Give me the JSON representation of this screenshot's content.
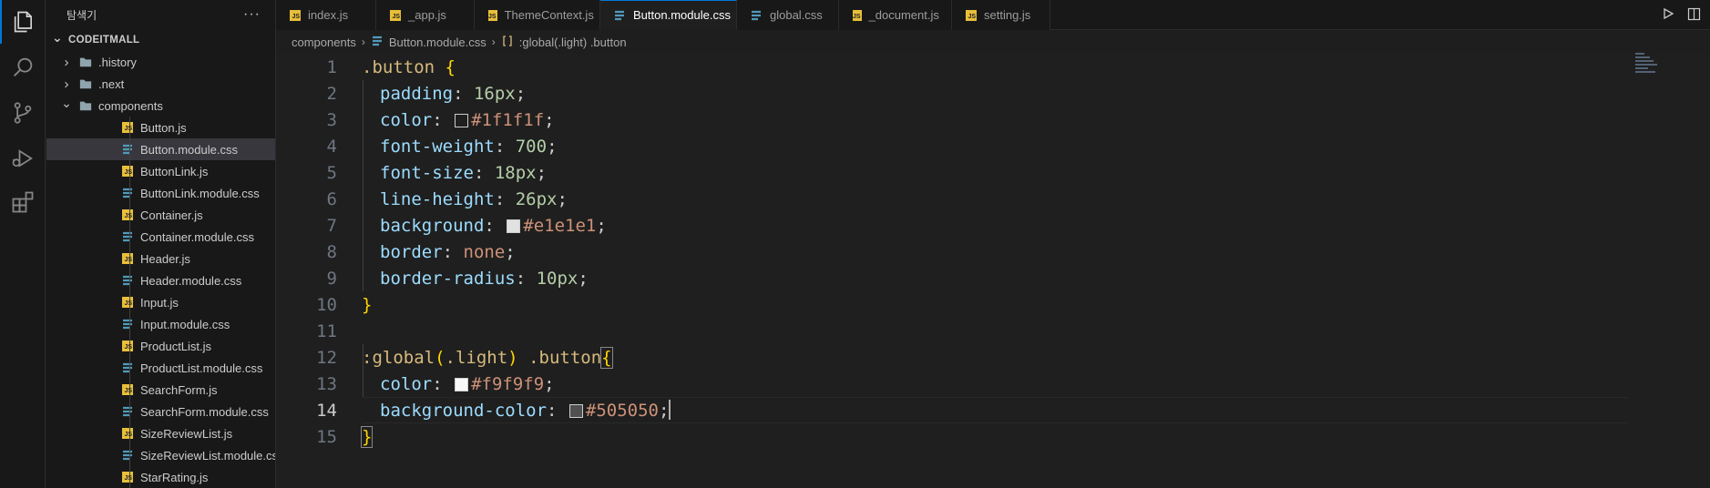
{
  "sidebar": {
    "title": "탐색기",
    "more_label": "···",
    "root": "CODEITMALL",
    "items": [
      {
        "label": ".history",
        "kind": "folder",
        "state": "collapsed"
      },
      {
        "label": ".next",
        "kind": "folder",
        "state": "collapsed"
      },
      {
        "label": "components",
        "kind": "folder",
        "state": "expanded"
      },
      {
        "label": "Button.js",
        "kind": "js"
      },
      {
        "label": "Button.module.css",
        "kind": "css",
        "selected": true
      },
      {
        "label": "ButtonLink.js",
        "kind": "js"
      },
      {
        "label": "ButtonLink.module.css",
        "kind": "css"
      },
      {
        "label": "Container.js",
        "kind": "js"
      },
      {
        "label": "Container.module.css",
        "kind": "css"
      },
      {
        "label": "Header.js",
        "kind": "js"
      },
      {
        "label": "Header.module.css",
        "kind": "css"
      },
      {
        "label": "Input.js",
        "kind": "js"
      },
      {
        "label": "Input.module.css",
        "kind": "css"
      },
      {
        "label": "ProductList.js",
        "kind": "js"
      },
      {
        "label": "ProductList.module.css",
        "kind": "css"
      },
      {
        "label": "SearchForm.js",
        "kind": "js"
      },
      {
        "label": "SearchForm.module.css",
        "kind": "css"
      },
      {
        "label": "SizeReviewList.js",
        "kind": "js"
      },
      {
        "label": "SizeReviewList.module.css",
        "kind": "css"
      },
      {
        "label": "StarRating.js",
        "kind": "js"
      }
    ]
  },
  "tabs": [
    {
      "label": "index.js",
      "kind": "js"
    },
    {
      "label": "_app.js",
      "kind": "js"
    },
    {
      "label": "ThemeContext.js",
      "kind": "js"
    },
    {
      "label": "Button.module.css",
      "kind": "css",
      "active": true,
      "close": "✕"
    },
    {
      "label": "global.css",
      "kind": "css"
    },
    {
      "label": "_document.js",
      "kind": "js"
    },
    {
      "label": "setting.js",
      "kind": "js"
    }
  ],
  "tab_actions": [
    "run-icon",
    "split-editor-icon"
  ],
  "breadcrumb": {
    "folder": "components",
    "file": "Button.module.css",
    "symbol": ":global(.light) .button"
  },
  "icons": {
    "js_badge": "JS",
    "chevron_right": "›",
    "chevron_down": "⌄"
  },
  "editor": {
    "current_line": 14,
    "line_numbers": [
      "1",
      "2",
      "3",
      "4",
      "5",
      "6",
      "7",
      "8",
      "9",
      "10",
      "11",
      "12",
      "13",
      "14",
      "15"
    ],
    "lines": {
      "l1": {
        "selector": ".button",
        "brace": " {"
      },
      "l2": {
        "prop": "padding",
        "colon": ": ",
        "value": "16px",
        "semi": ";"
      },
      "l3": {
        "prop": "color",
        "colon": ": ",
        "value": "#1f1f1f",
        "semi": ";",
        "swatch": "#1f1f1f"
      },
      "l4": {
        "prop": "font-weight",
        "colon": ": ",
        "value": "700",
        "semi": ";"
      },
      "l5": {
        "prop": "font-size",
        "colon": ": ",
        "value": "18px",
        "semi": ";"
      },
      "l6": {
        "prop": "line-height",
        "colon": ": ",
        "value": "26px",
        "semi": ";"
      },
      "l7": {
        "prop": "background",
        "colon": ": ",
        "value": "#e1e1e1",
        "semi": ";",
        "swatch": "#e1e1e1"
      },
      "l8": {
        "prop": "border",
        "colon": ": ",
        "value": "none",
        "semi": ";"
      },
      "l9": {
        "prop": "border-radius",
        "colon": ": ",
        "value": "10px",
        "semi": ";"
      },
      "l10": {
        "brace": "}"
      },
      "l12": {
        "pseudo": ":global",
        "paren_open": "(",
        "inner": ".light",
        "paren_close": ")",
        "selector": " .button",
        "brace": "{"
      },
      "l13": {
        "prop": "color",
        "colon": ": ",
        "value": "#f9f9f9",
        "semi": ";",
        "swatch": "#f9f9f9"
      },
      "l14": {
        "prop": "background-color",
        "colon": ": ",
        "value": "#505050",
        "semi": ";",
        "swatch": "#505050"
      },
      "l15": {
        "brace": "}"
      }
    }
  },
  "colors": {
    "accent": "#0078d4",
    "js_icon": "#e8bf3a",
    "css_icon": "#519aba"
  }
}
